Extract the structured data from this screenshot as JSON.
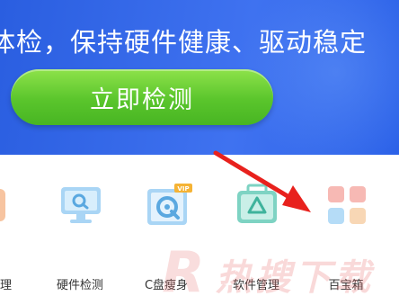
{
  "banner": {
    "headline": "体检，保持硬件健康、驱动稳定",
    "scan_button": "立即检测"
  },
  "tools": [
    {
      "label": "理",
      "icon": "hardware-manage-icon"
    },
    {
      "label": "硬件检测",
      "icon": "monitor-search-icon"
    },
    {
      "label": "C盘瘦身",
      "icon": "disk-slim-icon",
      "badge": "VIP"
    },
    {
      "label": "软件管理",
      "icon": "software-bag-icon"
    },
    {
      "label": "百宝箱",
      "icon": "grid-toolbox-icon"
    }
  ],
  "watermark": {
    "letter": "R",
    "text": "热搜下载"
  },
  "colors": {
    "banner": "#2f66e8",
    "button": "#5ac52c",
    "icon_blue": "#8cc4f0",
    "icon_teal": "#5cc9b5",
    "arrow": "#e8211d"
  }
}
